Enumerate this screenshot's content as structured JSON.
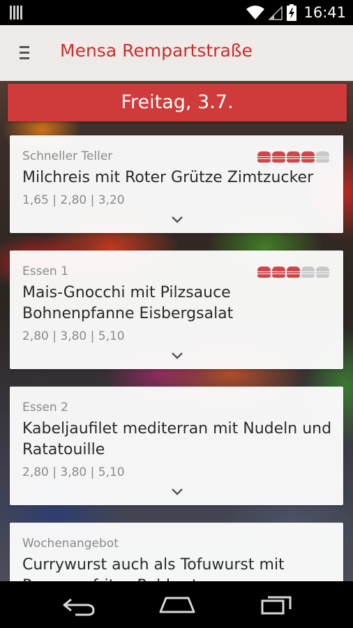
{
  "status_bar": {
    "time": "16:41",
    "icons": [
      "notification-icon",
      "wifi-icon",
      "signal-icon",
      "battery-charging-icon"
    ]
  },
  "toolbar": {
    "menu_icon": "hamburger-menu-icon",
    "title": "Mensa Rempartstraße",
    "title_color": "#cf2c2c"
  },
  "date_header": {
    "label": "Freitag, 3.7.",
    "color": "#cf3a3a"
  },
  "meals": [
    {
      "category": "Schneller Teller",
      "name": "Milchreis mit Roter Grütze Zimtzucker",
      "prices": "1,65 | 2,80 | 3,20",
      "rating": 4,
      "rating_max": 5
    },
    {
      "category": "Essen 1",
      "name": "Mais-Gnocchi mit Pilzsauce Bohnenpfanne Eisbergsalat",
      "prices": "2,80 | 3,80 | 5,10",
      "rating": 3,
      "rating_max": 5
    },
    {
      "category": "Essen 2",
      "name": "Kabeljaufilet mediterran mit Nudeln und Ratatouille",
      "prices": "2,80 | 3,80 | 5,10"
    },
    {
      "category": "Wochenangebot",
      "name": "Currywurst auch als Tofuwurst mit Pommes frites Rohkost"
    }
  ],
  "rating_colors": {
    "on": "#d0454a",
    "off": "#c8c8c8"
  },
  "nav_bar": {
    "buttons": [
      "back-icon",
      "home-icon",
      "recent-apps-icon"
    ]
  }
}
